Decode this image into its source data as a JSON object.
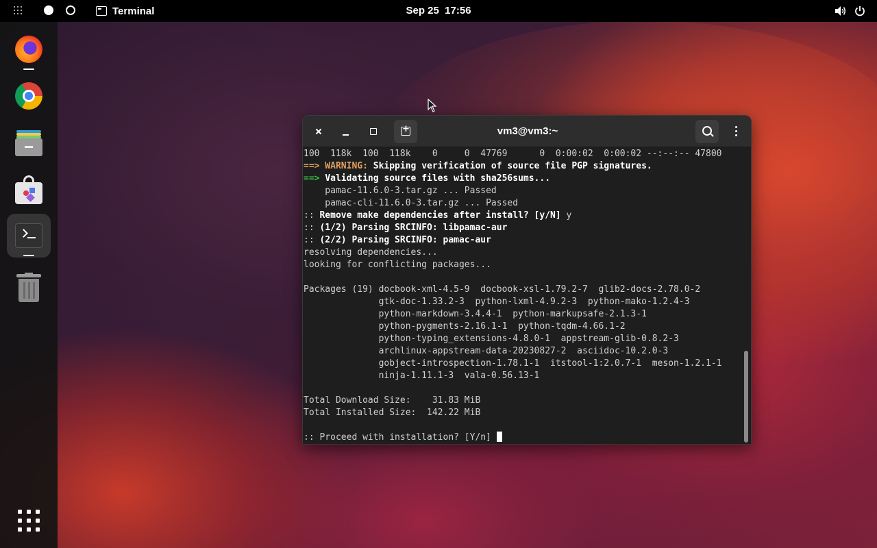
{
  "topbar": {
    "app_name": "Terminal",
    "clock": "Sep 25  17:56",
    "icons": [
      "apps-grid-icon",
      "workspace-active-icon",
      "workspace-icon",
      "volume-icon",
      "power-icon"
    ]
  },
  "dock": {
    "items": [
      {
        "name": "Firefox",
        "icon": "firefox-icon",
        "running": true
      },
      {
        "name": "Google Chrome",
        "icon": "chrome-icon",
        "running": false
      },
      {
        "name": "Files",
        "icon": "files-icon",
        "running": false
      },
      {
        "name": "Software",
        "icon": "software-store-icon",
        "running": false
      },
      {
        "name": "Terminal",
        "icon": "terminal-icon",
        "running": true,
        "active": true
      },
      {
        "name": "Trash",
        "icon": "trash-icon",
        "running": false
      }
    ],
    "show_apps_icon": "show-apps-icon"
  },
  "terminal": {
    "title": "vm3@vm3:~",
    "lines": [
      {
        "segments": [
          {
            "text": "100  118k  100  118k    0     0  47769      0  0:00:02  0:00:02 --:--:-- 47800",
            "style": ""
          }
        ]
      },
      {
        "segments": [
          {
            "text": "==> WARNING: ",
            "style": "warn"
          },
          {
            "text": "Skipping verification of source file PGP signatures.",
            "style": "b"
          }
        ]
      },
      {
        "segments": [
          {
            "text": "==> ",
            "style": "green"
          },
          {
            "text": "Validating source files with sha256sums...",
            "style": "b"
          }
        ]
      },
      {
        "segments": [
          {
            "text": "    pamac-11.6.0-3.tar.gz ... Passed",
            "style": ""
          }
        ]
      },
      {
        "segments": [
          {
            "text": "    pamac-cli-11.6.0-3.tar.gz ... Passed",
            "style": ""
          }
        ]
      },
      {
        "segments": [
          {
            "text": ":: ",
            "style": ""
          },
          {
            "text": "Remove make dependencies after install? [y/N]",
            "style": "b"
          },
          {
            "text": " y",
            "style": ""
          }
        ]
      },
      {
        "segments": [
          {
            "text": ":: ",
            "style": ""
          },
          {
            "text": "(1/2) Parsing SRCINFO: libpamac-aur",
            "style": "b"
          }
        ]
      },
      {
        "segments": [
          {
            "text": ":: ",
            "style": ""
          },
          {
            "text": "(2/2) Parsing SRCINFO: pamac-aur",
            "style": "b"
          }
        ]
      },
      {
        "segments": [
          {
            "text": "resolving dependencies...",
            "style": ""
          }
        ]
      },
      {
        "segments": [
          {
            "text": "looking for conflicting packages...",
            "style": ""
          }
        ]
      },
      {
        "segments": [
          {
            "text": "",
            "style": ""
          }
        ]
      },
      {
        "segments": [
          {
            "text": "Packages (19) docbook-xml-4.5-9  docbook-xsl-1.79.2-7  glib2-docs-2.78.0-2",
            "style": ""
          }
        ]
      },
      {
        "segments": [
          {
            "text": "              gtk-doc-1.33.2-3  python-lxml-4.9.2-3  python-mako-1.2.4-3",
            "style": ""
          }
        ]
      },
      {
        "segments": [
          {
            "text": "              python-markdown-3.4.4-1  python-markupsafe-2.1.3-1",
            "style": ""
          }
        ]
      },
      {
        "segments": [
          {
            "text": "              python-pygments-2.16.1-1  python-tqdm-4.66.1-2",
            "style": ""
          }
        ]
      },
      {
        "segments": [
          {
            "text": "              python-typing_extensions-4.8.0-1  appstream-glib-0.8.2-3",
            "style": ""
          }
        ]
      },
      {
        "segments": [
          {
            "text": "              archlinux-appstream-data-20230827-2  asciidoc-10.2.0-3",
            "style": ""
          }
        ]
      },
      {
        "segments": [
          {
            "text": "              gobject-introspection-1.78.1-1  itstool-1:2.0.7-1  meson-1.2.1-1",
            "style": ""
          }
        ]
      },
      {
        "segments": [
          {
            "text": "              ninja-1.11.1-3  vala-0.56.13-1",
            "style": ""
          }
        ]
      },
      {
        "segments": [
          {
            "text": "",
            "style": ""
          }
        ]
      },
      {
        "segments": [
          {
            "text": "Total Download Size:    31.83 MiB",
            "style": ""
          }
        ]
      },
      {
        "segments": [
          {
            "text": "Total Installed Size:  142.22 MiB",
            "style": ""
          }
        ]
      },
      {
        "segments": [
          {
            "text": "",
            "style": ""
          }
        ]
      },
      {
        "segments": [
          {
            "text": ":: Proceed with installation? [Y/n] ",
            "style": ""
          }
        ],
        "cursor": true
      }
    ]
  }
}
